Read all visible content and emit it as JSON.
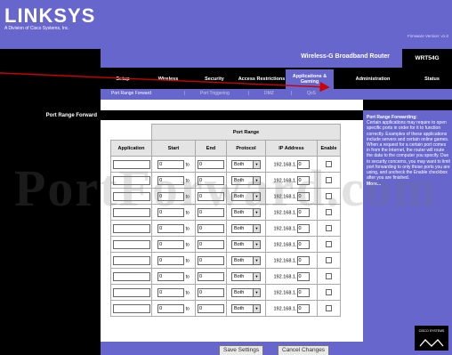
{
  "brand": {
    "logo": "LINKSYS",
    "subtitle": "A Division of Cisco Systems, Inc."
  },
  "firmware": "Firmware Version: v1.0",
  "section_title": "Applications & Gaming",
  "product_name": "Wireless-G Broadband Router",
  "model": "WRT54G",
  "tabs": [
    {
      "label": "Setup"
    },
    {
      "label": "Wireless"
    },
    {
      "label": "Security"
    },
    {
      "label": "Access Restrictions"
    },
    {
      "label": "Applications & Gaming"
    },
    {
      "label": "Administration"
    },
    {
      "label": "Status"
    }
  ],
  "subtabs": [
    {
      "label": "Port Range Forward"
    },
    {
      "label": "Port Triggering"
    },
    {
      "label": "DMZ"
    },
    {
      "label": "QoS"
    }
  ],
  "left_label": "Port Range Forward",
  "table": {
    "group_header": "Port Range",
    "headers": [
      "Application",
      "Start",
      "End",
      "Protocol",
      "IP Address",
      "Enable"
    ],
    "to_label": "to",
    "ip_prefix": "192.168.1.",
    "rows": [
      {
        "app": "",
        "start": "0",
        "end": "0",
        "protocol": "Both",
        "ip_last": "0",
        "enabled": false
      },
      {
        "app": "",
        "start": "0",
        "end": "0",
        "protocol": "Both",
        "ip_last": "0",
        "enabled": false
      },
      {
        "app": "",
        "start": "0",
        "end": "0",
        "protocol": "Both",
        "ip_last": "0",
        "enabled": false
      },
      {
        "app": "",
        "start": "0",
        "end": "0",
        "protocol": "Both",
        "ip_last": "0",
        "enabled": false
      },
      {
        "app": "",
        "start": "0",
        "end": "0",
        "protocol": "Both",
        "ip_last": "0",
        "enabled": false
      },
      {
        "app": "",
        "start": "0",
        "end": "0",
        "protocol": "Both",
        "ip_last": "0",
        "enabled": false
      },
      {
        "app": "",
        "start": "0",
        "end": "0",
        "protocol": "Both",
        "ip_last": "0",
        "enabled": false
      },
      {
        "app": "",
        "start": "0",
        "end": "0",
        "protocol": "Both",
        "ip_last": "0",
        "enabled": false
      },
      {
        "app": "",
        "start": "0",
        "end": "0",
        "protocol": "Both",
        "ip_last": "0",
        "enabled": false
      },
      {
        "app": "",
        "start": "0",
        "end": "0",
        "protocol": "Both",
        "ip_last": "0",
        "enabled": false
      }
    ]
  },
  "help": {
    "title": "Port Range Forwarding:",
    "body": "Certain applications may require to open specific ports in order for it to function correctly. Examples of these applications include servers and certain online games. When a request for a certain port comes in from the Internet, the router will route the data to the computer you specify. Due to security concerns, you may want to limit port forwarding to only those ports you are using, and uncheck the Enable checkbox after you are finished.",
    "more": "More..."
  },
  "buttons": {
    "save": "Save Settings",
    "cancel": "Cancel Changes"
  },
  "cisco_label": "CISCO SYSTEMS",
  "watermark": "PortForward.com",
  "colors": {
    "accent": "#6666cc",
    "black": "#000000",
    "arrow": "#cc0000"
  }
}
